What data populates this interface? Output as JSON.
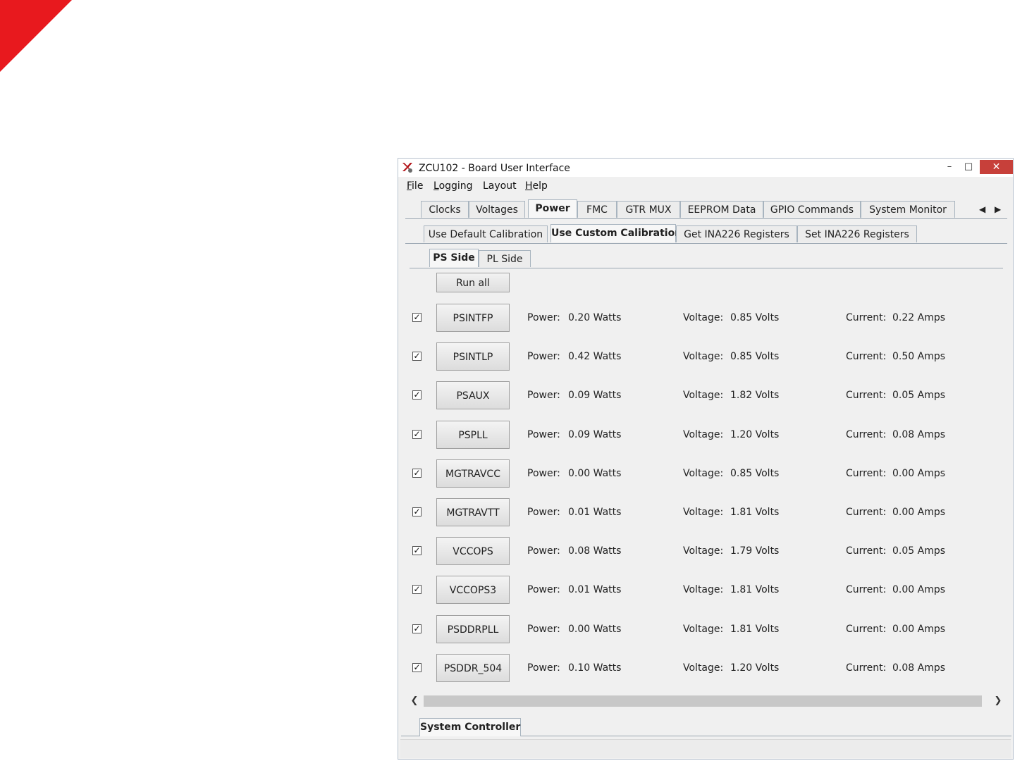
{
  "window": {
    "title": "ZCU102 - Board User Interface"
  },
  "menu": [
    {
      "acc": "F",
      "rest": "ile"
    },
    {
      "acc": "L",
      "rest": "ogging"
    },
    {
      "acc": "",
      "rest": "Layout"
    },
    {
      "acc": "H",
      "rest": "elp"
    }
  ],
  "main_tabs": [
    "Clocks",
    "Voltages",
    "Power",
    "FMC",
    "GTR MUX",
    "EEPROM Data",
    "GPIO Commands",
    "System Monitor"
  ],
  "active_main_tab": "Power",
  "calib_tabs": [
    "Use Default Calibration",
    "Use Custom Calibration",
    "Get INA226 Registers",
    "Set INA226 Registers"
  ],
  "side_tabs": [
    "PS Side",
    "PL Side"
  ],
  "run_all_label": "Run all",
  "labels": {
    "power": "Power:",
    "voltage": "Voltage:",
    "current": "Current:"
  },
  "rails": [
    {
      "name": "PSINTFP",
      "power": "0.20 Watts",
      "voltage": "0.85 Volts",
      "current": "0.22 Amps",
      "checked": true
    },
    {
      "name": "PSINTLP",
      "power": "0.42 Watts",
      "voltage": "0.85 Volts",
      "current": "0.50 Amps",
      "checked": true
    },
    {
      "name": "PSAUX",
      "power": "0.09 Watts",
      "voltage": "1.82 Volts",
      "current": "0.05 Amps",
      "checked": true
    },
    {
      "name": "PSPLL",
      "power": "0.09 Watts",
      "voltage": "1.20 Volts",
      "current": "0.08 Amps",
      "checked": true
    },
    {
      "name": "MGTRAVCC",
      "power": "0.00 Watts",
      "voltage": "0.85 Volts",
      "current": "0.00 Amps",
      "checked": true
    },
    {
      "name": "MGTRAVTT",
      "power": "0.01 Watts",
      "voltage": "1.81 Volts",
      "current": "0.00 Amps",
      "checked": true
    },
    {
      "name": "VCCOPS",
      "power": "0.08 Watts",
      "voltage": "1.79 Volts",
      "current": "0.05 Amps",
      "checked": true
    },
    {
      "name": "VCCOPS3",
      "power": "0.01 Watts",
      "voltage": "1.81 Volts",
      "current": "0.00 Amps",
      "checked": true
    },
    {
      "name": "PSDDRPLL",
      "power": "0.00 Watts",
      "voltage": "1.81 Volts",
      "current": "0.00 Amps",
      "checked": true
    },
    {
      "name": "PSDDR_504",
      "power": "0.10 Watts",
      "voltage": "1.20 Volts",
      "current": "0.08 Amps",
      "checked": true
    }
  ],
  "bottom_tab": "System Controller",
  "colors": {
    "accent_red": "#e8191e",
    "close_button": "#c7403a"
  }
}
